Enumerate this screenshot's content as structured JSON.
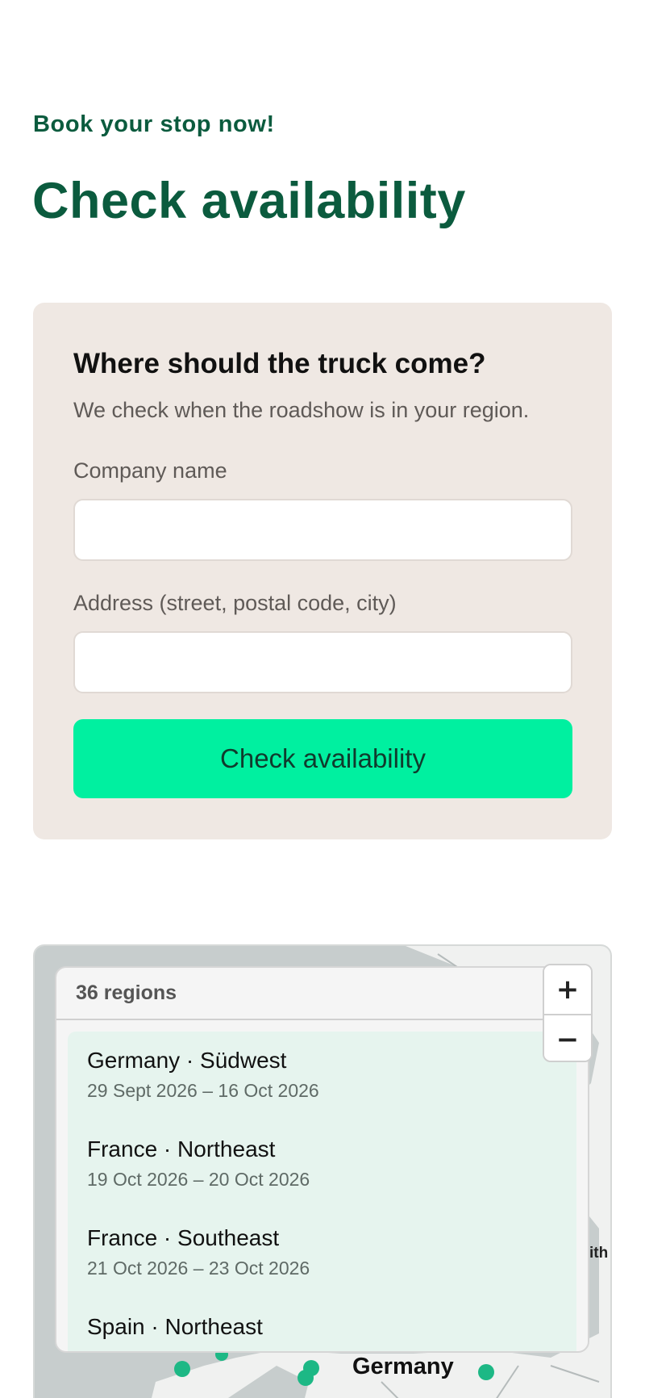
{
  "header": {
    "eyebrow": "Book your stop now!",
    "title": "Check availability"
  },
  "form": {
    "title": "Where should the truck come?",
    "subtitle": "We check when the roadshow is in your region.",
    "company_label": "Company name",
    "company_value": "",
    "address_label": "Address (street, postal code, city)",
    "address_value": "",
    "submit_label": "Check availability"
  },
  "map": {
    "regions_count_label": "36 regions",
    "zoom_in": "+",
    "zoom_out": "−",
    "country_label": "Germany",
    "edge_text": "ith",
    "marker_color": "#1db885",
    "regions": [
      {
        "name": "Germany · Südwest",
        "dates": "29 Sept 2026 – 16 Oct 2026"
      },
      {
        "name": "France · Northeast",
        "dates": "19 Oct 2026 – 20 Oct 2026"
      },
      {
        "name": "France · Southeast",
        "dates": "21 Oct 2026 – 23 Oct 2026"
      },
      {
        "name": "Spain · Northeast",
        "dates": ""
      }
    ]
  }
}
